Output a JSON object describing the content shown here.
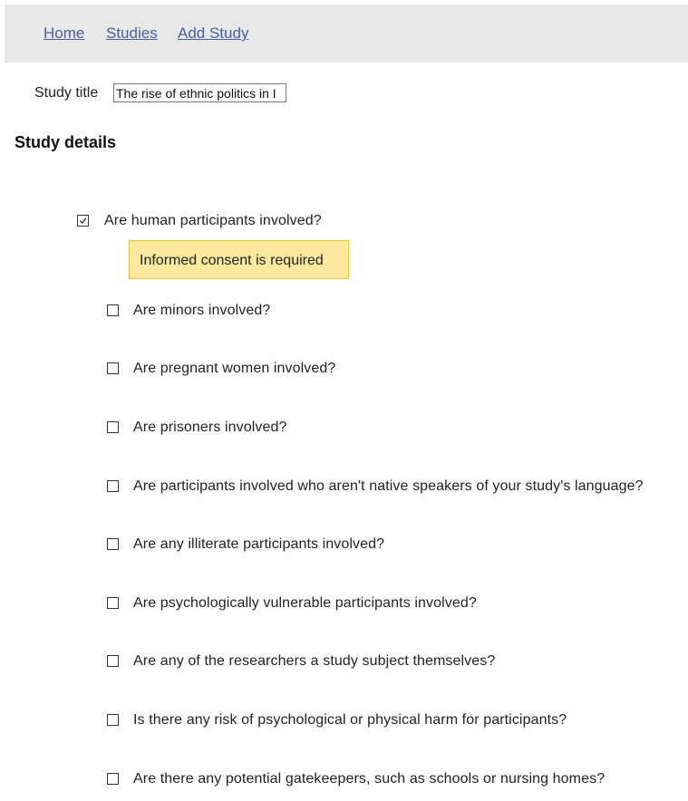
{
  "nav": {
    "home": "Home",
    "studies": "Studies",
    "add_study": "Add Study"
  },
  "study": {
    "title_label": "Study title",
    "title_value": "The rise of ethnic politics in I"
  },
  "section": {
    "heading": "Study details"
  },
  "human_participants": {
    "question": "Are human participants involved?",
    "checked": true,
    "note": "Informed consent is required"
  },
  "questions": [
    {
      "label": "Are minors involved?",
      "checked": false
    },
    {
      "label": "Are pregnant women involved?",
      "checked": false
    },
    {
      "label": "Are prisoners involved?",
      "checked": false
    },
    {
      "label": "Are participants involved who aren't native speakers of your study's language?",
      "checked": false
    },
    {
      "label": "Are any illiterate participants involved?",
      "checked": false
    },
    {
      "label": "Are psychologically vulnerable participants involved?",
      "checked": false
    },
    {
      "label": "Are any of the researchers a study subject themselves?",
      "checked": false
    },
    {
      "label": "Is there any risk of psychological or physical harm for participants?",
      "checked": false
    },
    {
      "label": "Are there any potential gatekeepers, such as schools or nursing homes?",
      "checked": false
    }
  ]
}
